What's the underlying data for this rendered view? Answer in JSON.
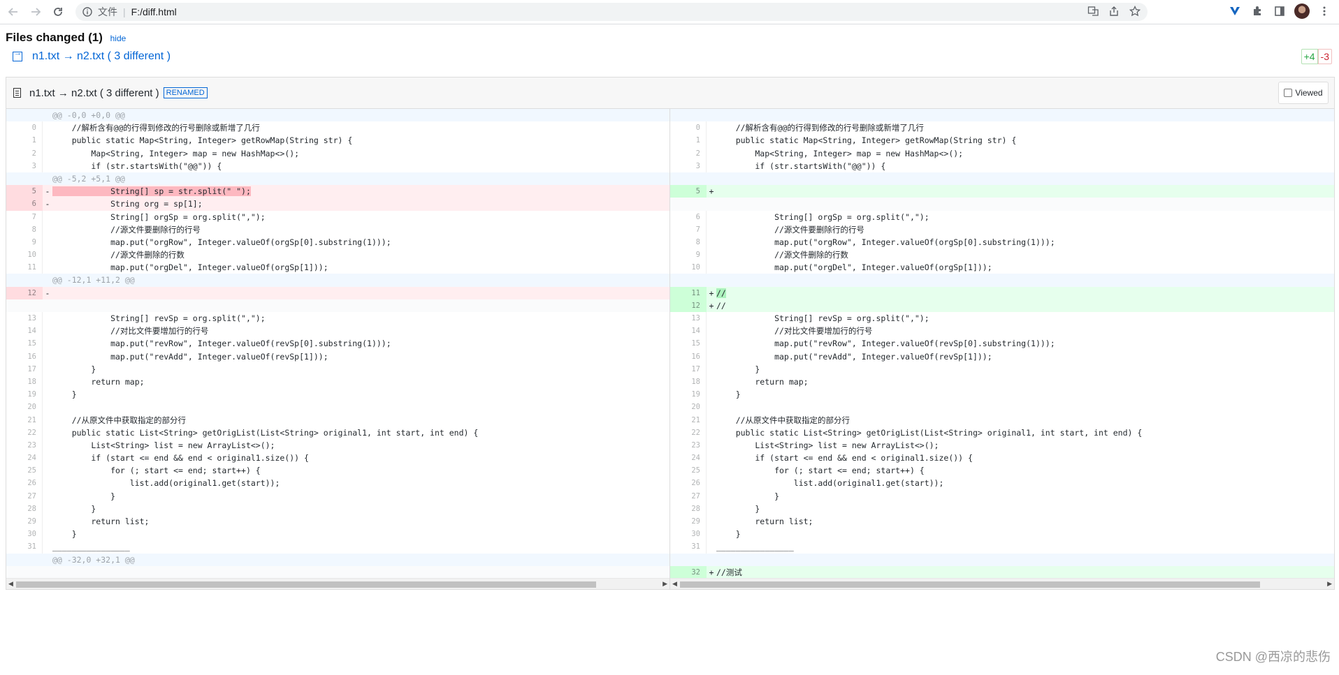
{
  "browser": {
    "omnibox_label": "文件",
    "url": "F:/diff.html"
  },
  "summary": {
    "title": "Files changed (1)",
    "hide_label": "hide",
    "file_link": "n1.txt → n2.txt ( 3 different )",
    "additions": "+4",
    "deletions": "-3"
  },
  "file": {
    "name": "n1.txt → n2.txt ( 3 different )",
    "tag": "RENAMED",
    "viewed_label": "Viewed"
  },
  "colors": {
    "accent": "#0366d6",
    "add_bg": "#e6ffed",
    "del_bg": "#ffeef0",
    "add_highlight": "#acf2bd",
    "del_highlight": "#fdb8c0"
  },
  "left_rows": [
    {
      "type": "hunk",
      "ln": "",
      "p": "",
      "code": "@@ -0,0 +0,0 @@"
    },
    {
      "type": "ctx",
      "ln": "0",
      "p": "",
      "code": "    //解析含有@@的行得到修改的行号删除或新增了几行"
    },
    {
      "type": "ctx",
      "ln": "1",
      "p": "",
      "code": "    public static Map<String, Integer> getRowMap(String str) {"
    },
    {
      "type": "ctx",
      "ln": "2",
      "p": "",
      "code": "        Map<String, Integer> map = new HashMap<>();"
    },
    {
      "type": "ctx",
      "ln": "3",
      "p": "",
      "code": "        if (str.startsWith(\"@@\")) {"
    },
    {
      "type": "hunk",
      "ln": "",
      "p": "",
      "code": "@@ -5,2 +5,1 @@"
    },
    {
      "type": "del",
      "ln": "5",
      "p": "-",
      "code": "            String[] sp = str.split(\" \");",
      "hl": true
    },
    {
      "type": "del",
      "ln": "6",
      "p": "-",
      "code": "            String org = sp[1];"
    },
    {
      "type": "ctx",
      "ln": "7",
      "p": "",
      "code": "            String[] orgSp = org.split(\",\");"
    },
    {
      "type": "ctx",
      "ln": "8",
      "p": "",
      "code": "            //源文件要删除行的行号"
    },
    {
      "type": "ctx",
      "ln": "9",
      "p": "",
      "code": "            map.put(\"orgRow\", Integer.valueOf(orgSp[0].substring(1)));"
    },
    {
      "type": "ctx",
      "ln": "10",
      "p": "",
      "code": "            //源文件删除的行数"
    },
    {
      "type": "ctx",
      "ln": "11",
      "p": "",
      "code": "            map.put(\"orgDel\", Integer.valueOf(orgSp[1]));"
    },
    {
      "type": "hunk",
      "ln": "",
      "p": "",
      "code": "@@ -12,1 +11,2 @@"
    },
    {
      "type": "del",
      "ln": "12",
      "p": "-",
      "code": ""
    },
    {
      "type": "empty",
      "ln": "",
      "p": "",
      "code": ""
    },
    {
      "type": "ctx",
      "ln": "13",
      "p": "",
      "code": "            String[] revSp = org.split(\",\");"
    },
    {
      "type": "ctx",
      "ln": "14",
      "p": "",
      "code": "            //对比文件要增加行的行号"
    },
    {
      "type": "ctx",
      "ln": "15",
      "p": "",
      "code": "            map.put(\"revRow\", Integer.valueOf(revSp[0].substring(1)));"
    },
    {
      "type": "ctx",
      "ln": "16",
      "p": "",
      "code": "            map.put(\"revAdd\", Integer.valueOf(revSp[1]));"
    },
    {
      "type": "ctx",
      "ln": "17",
      "p": "",
      "code": "        }"
    },
    {
      "type": "ctx",
      "ln": "18",
      "p": "",
      "code": "        return map;"
    },
    {
      "type": "ctx",
      "ln": "19",
      "p": "",
      "code": "    }"
    },
    {
      "type": "ctx",
      "ln": "20",
      "p": "",
      "code": ""
    },
    {
      "type": "ctx",
      "ln": "21",
      "p": "",
      "code": "    //从原文件中获取指定的部分行"
    },
    {
      "type": "ctx",
      "ln": "22",
      "p": "",
      "code": "    public static List<String> getOrigList(List<String> original1, int start, int end) {"
    },
    {
      "type": "ctx",
      "ln": "23",
      "p": "",
      "code": "        List<String> list = new ArrayList<>();"
    },
    {
      "type": "ctx",
      "ln": "24",
      "p": "",
      "code": "        if (start <= end && end < original1.size()) {"
    },
    {
      "type": "ctx",
      "ln": "25",
      "p": "",
      "code": "            for (; start <= end; start++) {"
    },
    {
      "type": "ctx",
      "ln": "26",
      "p": "",
      "code": "                list.add(original1.get(start));"
    },
    {
      "type": "ctx",
      "ln": "27",
      "p": "",
      "code": "            }"
    },
    {
      "type": "ctx",
      "ln": "28",
      "p": "",
      "code": "        }"
    },
    {
      "type": "ctx",
      "ln": "29",
      "p": "",
      "code": "        return list;"
    },
    {
      "type": "ctx",
      "ln": "30",
      "p": "",
      "code": "    }"
    },
    {
      "type": "ctx",
      "ln": "31",
      "p": "",
      "code": "________________"
    },
    {
      "type": "hunk",
      "ln": "",
      "p": "",
      "code": "@@ -32,0 +32,1 @@"
    },
    {
      "type": "empty",
      "ln": "",
      "p": "",
      "code": ""
    }
  ],
  "right_rows": [
    {
      "type": "hunk",
      "ln": "",
      "p": "",
      "code": ""
    },
    {
      "type": "ctx",
      "ln": "0",
      "p": "",
      "code": "    //解析含有@@的行得到修改的行号删除或新增了几行"
    },
    {
      "type": "ctx",
      "ln": "1",
      "p": "",
      "code": "    public static Map<String, Integer> getRowMap(String str) {"
    },
    {
      "type": "ctx",
      "ln": "2",
      "p": "",
      "code": "        Map<String, Integer> map = new HashMap<>();"
    },
    {
      "type": "ctx",
      "ln": "3",
      "p": "",
      "code": "        if (str.startsWith(\"@@\")) {"
    },
    {
      "type": "hunk",
      "ln": "",
      "p": "",
      "code": ""
    },
    {
      "type": "add",
      "ln": "5",
      "p": "+",
      "code": ""
    },
    {
      "type": "empty",
      "ln": "",
      "p": "",
      "code": ""
    },
    {
      "type": "ctx",
      "ln": "6",
      "p": "",
      "code": "            String[] orgSp = org.split(\",\");"
    },
    {
      "type": "ctx",
      "ln": "7",
      "p": "",
      "code": "            //源文件要删除行的行号"
    },
    {
      "type": "ctx",
      "ln": "8",
      "p": "",
      "code": "            map.put(\"orgRow\", Integer.valueOf(orgSp[0].substring(1)));"
    },
    {
      "type": "ctx",
      "ln": "9",
      "p": "",
      "code": "            //源文件删除的行数"
    },
    {
      "type": "ctx",
      "ln": "10",
      "p": "",
      "code": "            map.put(\"orgDel\", Integer.valueOf(orgSp[1]));"
    },
    {
      "type": "hunk",
      "ln": "",
      "p": "",
      "code": ""
    },
    {
      "type": "add",
      "ln": "11",
      "p": "+",
      "code": "//",
      "hl": true
    },
    {
      "type": "add",
      "ln": "12",
      "p": "+",
      "code": "//"
    },
    {
      "type": "ctx",
      "ln": "13",
      "p": "",
      "code": "            String[] revSp = org.split(\",\");"
    },
    {
      "type": "ctx",
      "ln": "14",
      "p": "",
      "code": "            //对比文件要增加行的行号"
    },
    {
      "type": "ctx",
      "ln": "15",
      "p": "",
      "code": "            map.put(\"revRow\", Integer.valueOf(revSp[0].substring(1)));"
    },
    {
      "type": "ctx",
      "ln": "16",
      "p": "",
      "code": "            map.put(\"revAdd\", Integer.valueOf(revSp[1]));"
    },
    {
      "type": "ctx",
      "ln": "17",
      "p": "",
      "code": "        }"
    },
    {
      "type": "ctx",
      "ln": "18",
      "p": "",
      "code": "        return map;"
    },
    {
      "type": "ctx",
      "ln": "19",
      "p": "",
      "code": "    }"
    },
    {
      "type": "ctx",
      "ln": "20",
      "p": "",
      "code": ""
    },
    {
      "type": "ctx",
      "ln": "21",
      "p": "",
      "code": "    //从原文件中获取指定的部分行"
    },
    {
      "type": "ctx",
      "ln": "22",
      "p": "",
      "code": "    public static List<String> getOrigList(List<String> original1, int start, int end) {"
    },
    {
      "type": "ctx",
      "ln": "23",
      "p": "",
      "code": "        List<String> list = new ArrayList<>();"
    },
    {
      "type": "ctx",
      "ln": "24",
      "p": "",
      "code": "        if (start <= end && end < original1.size()) {"
    },
    {
      "type": "ctx",
      "ln": "25",
      "p": "",
      "code": "            for (; start <= end; start++) {"
    },
    {
      "type": "ctx",
      "ln": "26",
      "p": "",
      "code": "                list.add(original1.get(start));"
    },
    {
      "type": "ctx",
      "ln": "27",
      "p": "",
      "code": "            }"
    },
    {
      "type": "ctx",
      "ln": "28",
      "p": "",
      "code": "        }"
    },
    {
      "type": "ctx",
      "ln": "29",
      "p": "",
      "code": "        return list;"
    },
    {
      "type": "ctx",
      "ln": "30",
      "p": "",
      "code": "    }"
    },
    {
      "type": "ctx",
      "ln": "31",
      "p": "",
      "code": "________________"
    },
    {
      "type": "hunk",
      "ln": "",
      "p": "",
      "code": ""
    },
    {
      "type": "add",
      "ln": "32",
      "p": "+",
      "code": "//测试"
    }
  ],
  "watermark": "CSDN @西凉的悲伤"
}
